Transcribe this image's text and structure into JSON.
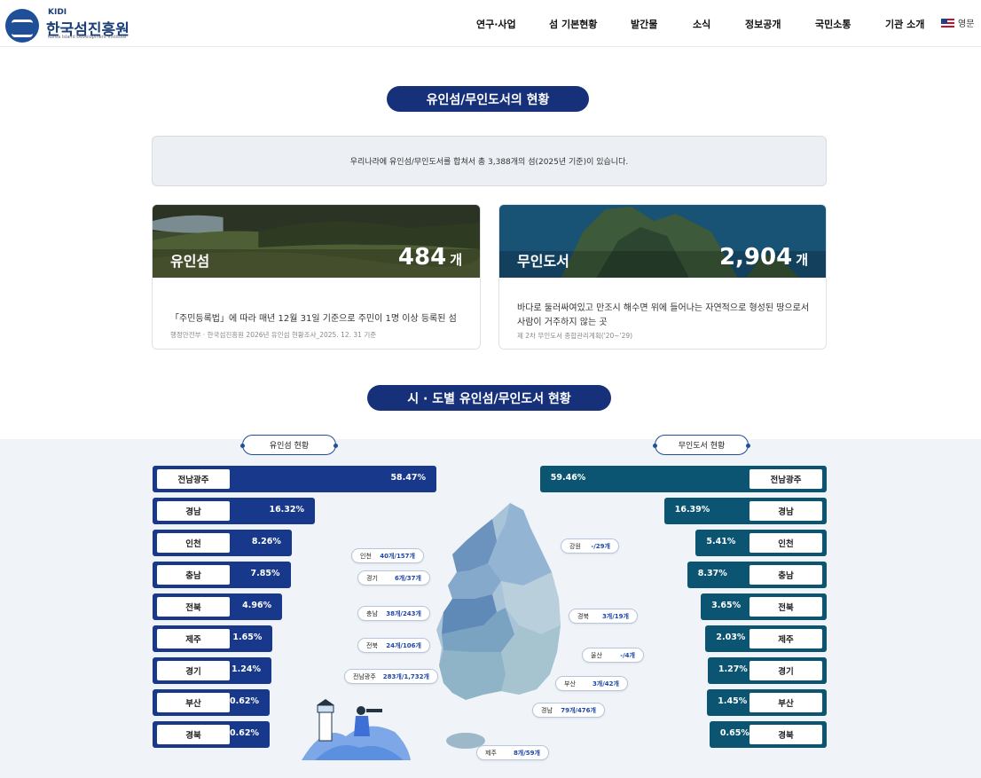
{
  "header": {
    "logo_kidi": "KIDI",
    "logo_name": "한국섬진흥원",
    "logo_sub": "Korea Island Development Institute",
    "nav": [
      "연구·사업",
      "섬 기본현황",
      "발간물",
      "소식",
      "정보공개",
      "국민소통",
      "기관 소개"
    ],
    "lang": "영문"
  },
  "section1": {
    "title": "유인섬/무인도서의 현황",
    "notice": "우리나라에 유인섬/무인도서를 합쳐서 총 3,388개의 섬(2025년 기준)이 있습니다."
  },
  "cards": [
    {
      "title": "유인섬",
      "count": "484",
      "unit": "개",
      "desc": "「주민등록법」에 따라 매년 12월 31일 기준으로 주민이 1명 이상 등록된 섬",
      "source": "행정안전부 · 한국섬진흥원 2026년 유인섬 현황조사_2025. 12. 31 기준"
    },
    {
      "title": "무인도서",
      "count": "2,904",
      "unit": "개",
      "desc": "바다로 둘러싸여있고 만조시 해수면 위에 들어나는 자연적으로 형성된 땅으로서 사람이 거주하지 않는 곳",
      "source": "제 2차 무인도서 종합관리계획('20~'29)"
    }
  ],
  "section2": {
    "title": "시 · 도별 유인섬/무인도서 현황",
    "left_title": "유인섬 현황",
    "right_title": "무인도서 현황"
  },
  "inhabited": [
    {
      "region": "전남광주",
      "pct": "58.47%",
      "value": 58.47
    },
    {
      "region": "경남",
      "pct": "16.32%",
      "value": 16.32
    },
    {
      "region": "인천",
      "pct": "8.26%",
      "value": 8.26
    },
    {
      "region": "충남",
      "pct": "7.85%",
      "value": 7.85
    },
    {
      "region": "전북",
      "pct": "4.96%",
      "value": 4.96
    },
    {
      "region": "제주",
      "pct": "1.65%",
      "value": 1.65
    },
    {
      "region": "경기",
      "pct": "1.24%",
      "value": 1.24
    },
    {
      "region": "부산",
      "pct": "0.62%",
      "value": 0.62
    },
    {
      "region": "경북",
      "pct": "0.62%",
      "value": 0.62
    }
  ],
  "uninhabited": [
    {
      "region": "전남광주",
      "pct": "59.46%",
      "value": 59.46
    },
    {
      "region": "경남",
      "pct": "16.39%",
      "value": 16.39
    },
    {
      "region": "인천",
      "pct": "5.41%",
      "value": 5.41
    },
    {
      "region": "충남",
      "pct": "8.37%",
      "value": 8.37
    },
    {
      "region": "전북",
      "pct": "3.65%",
      "value": 3.65
    },
    {
      "region": "제주",
      "pct": "2.03%",
      "value": 2.03
    },
    {
      "region": "경기",
      "pct": "1.27%",
      "value": 1.27
    },
    {
      "region": "부산",
      "pct": "1.45%",
      "value": 1.45
    },
    {
      "region": "경북",
      "pct": "0.65%",
      "value": 0.65
    }
  ],
  "map_tags": [
    {
      "region": "인천",
      "value": "40개/157개"
    },
    {
      "region": "경기",
      "value": "6개/37개"
    },
    {
      "region": "충남",
      "value": "38개/243개"
    },
    {
      "region": "전북",
      "value": "24개/106개"
    },
    {
      "region": "전남광주",
      "value": "283개/1,732개"
    },
    {
      "region": "강원",
      "value": "-/29개"
    },
    {
      "region": "경북",
      "value": "3개/19개"
    },
    {
      "region": "울산",
      "value": "-/4개"
    },
    {
      "region": "부산",
      "value": "3개/42개"
    },
    {
      "region": "경남",
      "value": "79개/476개"
    },
    {
      "region": "제주",
      "value": "8개/59개"
    }
  ],
  "colors": {
    "navy": "#16307a",
    "bar_left": "#17388b",
    "bar_right": "#0b5573",
    "band": "#f0f4f9"
  }
}
